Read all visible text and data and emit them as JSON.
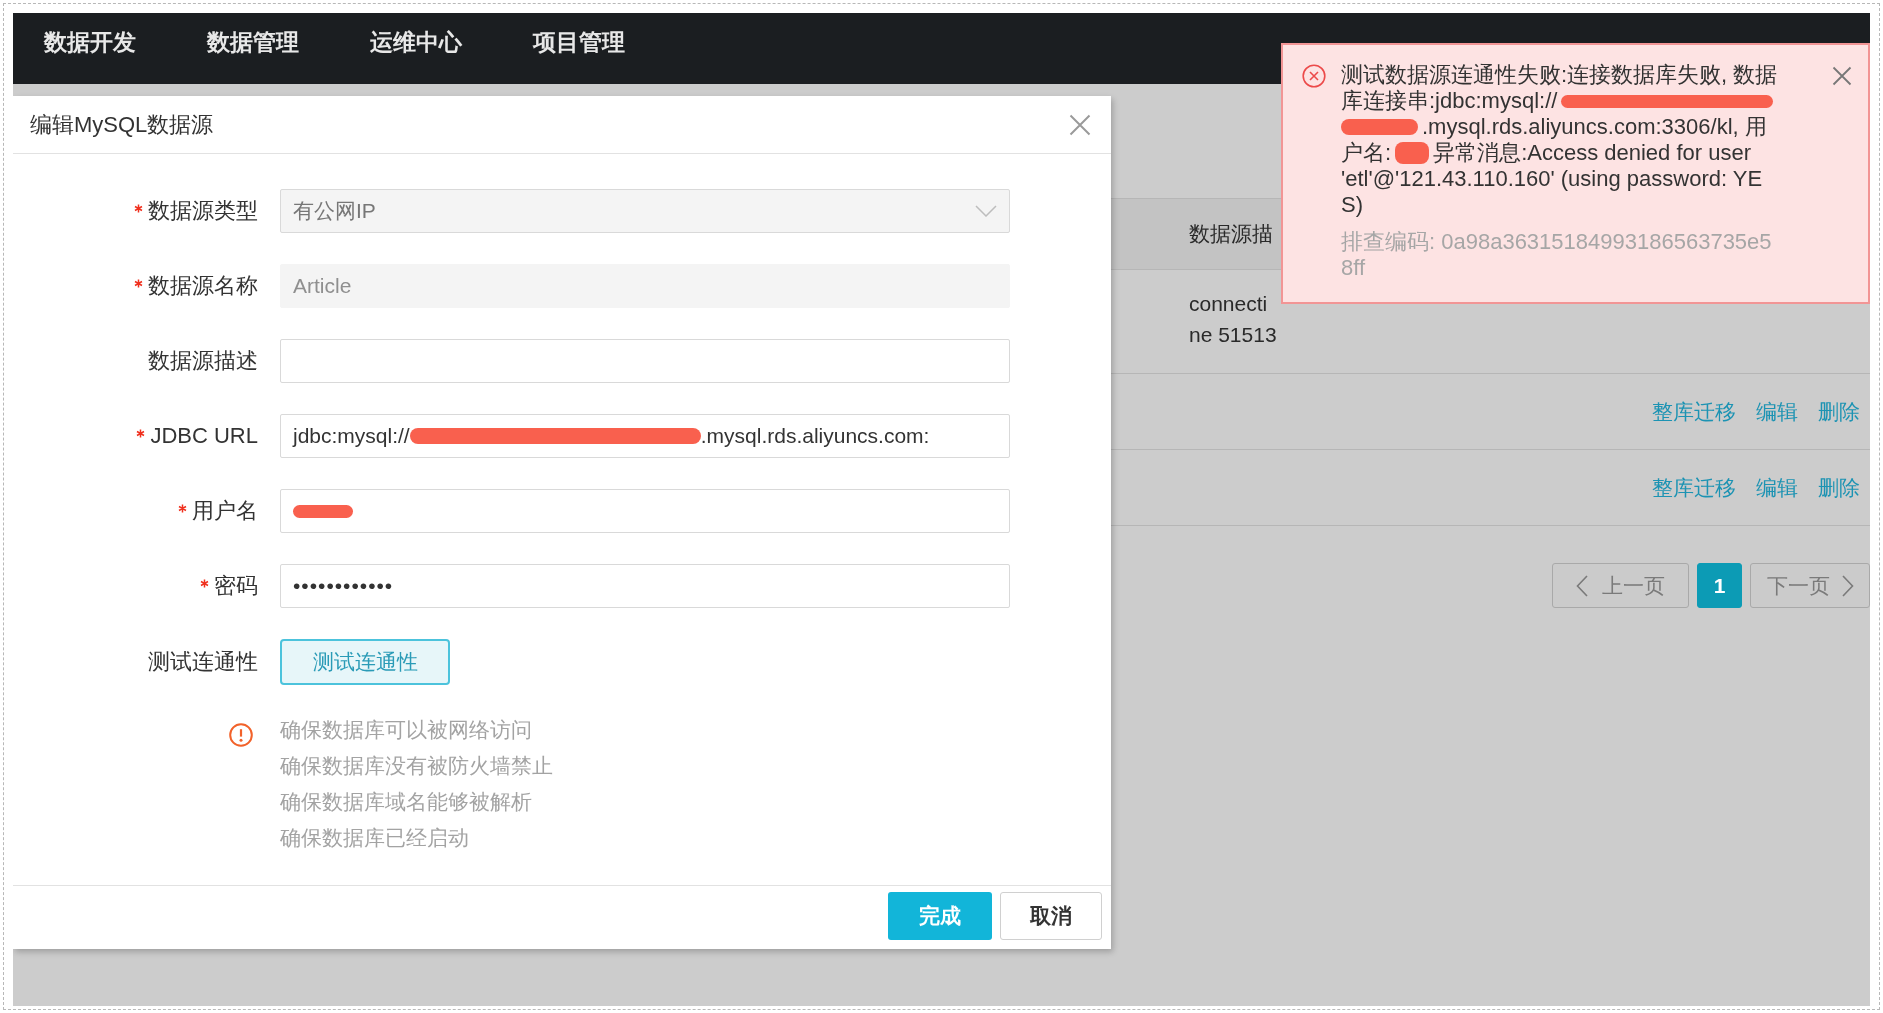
{
  "nav": {
    "items": [
      "数据开发",
      "数据管理",
      "运维中心",
      "项目管理"
    ]
  },
  "dialog": {
    "title": "编辑MySQL数据源",
    "fields": [
      {
        "kind": "select",
        "label": "数据源类型",
        "required": true,
        "disabled": true,
        "value": "有公网IP"
      },
      {
        "kind": "text",
        "label": "数据源名称",
        "required": true,
        "disabled": true,
        "value": "Article"
      },
      {
        "kind": "text",
        "label": "数据源描述",
        "required": false,
        "disabled": false
      },
      {
        "kind": "text",
        "label": "JDBC URL",
        "required": true,
        "disabled": false,
        "value_parts": [
          {
            "kind": "text",
            "text": "jdbc:mysql://"
          },
          {
            "kind": "redaction"
          },
          {
            "kind": "text",
            "text": ".mysql.rds.aliyuncs.com:"
          }
        ]
      },
      {
        "kind": "text",
        "label": "用户名",
        "required": true,
        "disabled": false,
        "value_parts": [
          {
            "kind": "redaction"
          }
        ]
      },
      {
        "kind": "password",
        "label": "密码",
        "required": true,
        "disabled": false,
        "value": "••••••••••••"
      },
      {
        "kind": "button",
        "label": "测试连通性",
        "required": false,
        "disabled": false,
        "button": "测试连通性"
      }
    ],
    "tips": [
      "确保数据库可以被网络访问",
      "确保数据库没有被防火墙禁止",
      "确保数据库域名能够被解析",
      "确保数据库已经启动"
    ],
    "buttons": [
      {
        "kind": "primary",
        "label": "完成"
      },
      {
        "kind": "default",
        "label": "取消"
      }
    ]
  },
  "background_table": {
    "columns": [
      "数据源描"
    ],
    "rows": [
      {
        "description_lines": [
          "connecti",
          "ne 51513"
        ]
      },
      {
        "actions": [
          "整库迁移",
          "编辑",
          "删除"
        ]
      },
      {
        "actions": [
          "整库迁移",
          "编辑",
          "删除"
        ]
      }
    ]
  },
  "pagination": {
    "prev": "上一页",
    "pages": [
      {
        "label": "1",
        "selected": true
      }
    ],
    "next": "下一页"
  },
  "toast": {
    "message_lines": [
      [
        {
          "kind": "text",
          "text": "测试数据源连通性失败:连接数据库失败, 数据"
        }
      ],
      [
        {
          "kind": "text",
          "text": "库连接串:jdbc:mysql://"
        },
        {
          "kind": "redaction"
        }
      ],
      [
        {
          "kind": "redaction"
        },
        {
          "kind": "text",
          "text": ".mysql.rds.aliyuncs.com:3306/kl, 用"
        }
      ],
      [
        {
          "kind": "text",
          "text": "户名:"
        },
        {
          "kind": "redaction"
        },
        {
          "kind": "text",
          "text": "异常消息:Access denied for user"
        }
      ],
      [
        {
          "kind": "text",
          "text": "'etl'@'121.43.110.160' (using password: YE"
        }
      ],
      [
        {
          "kind": "text",
          "text": "S)"
        }
      ]
    ],
    "trace_label": "排查编码: 0a98a36315184993186563735e58ff"
  }
}
